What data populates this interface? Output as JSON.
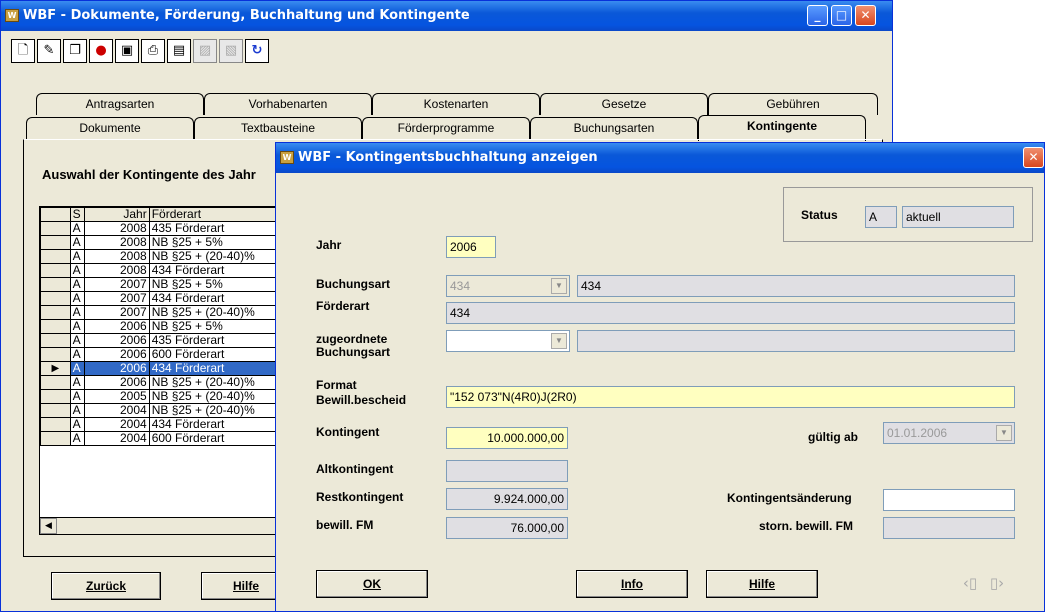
{
  "main_window": {
    "title": "WBF - Dokumente, Förderung, Buchhaltung und Kontingente",
    "controls": {
      "minimize": "_",
      "maximize": "□",
      "close": "✕"
    },
    "tabs_row1": [
      "Antragsarten",
      "Vorhabenarten",
      "Kostenarten",
      "Gesetze",
      "Gebühren"
    ],
    "tabs_row2": [
      "Dokumente",
      "Textbausteine",
      "Förderprogramme",
      "Buchungsarten",
      "Kontingente"
    ],
    "section_title": "Auswahl der Kontingente des Jahr",
    "table": {
      "headers": [
        "S",
        "Jahr",
        "Förderart"
      ],
      "rows": [
        [
          "A",
          "2008",
          "435 Förderart"
        ],
        [
          "A",
          "2008",
          "NB §25 + 5%"
        ],
        [
          "A",
          "2008",
          "NB §25 + (20-40)%"
        ],
        [
          "A",
          "2008",
          "434 Förderart"
        ],
        [
          "A",
          "2007",
          "NB §25 + 5%"
        ],
        [
          "A",
          "2007",
          "434 Förderart"
        ],
        [
          "A",
          "2007",
          "NB §25 + (20-40)%"
        ],
        [
          "A",
          "2006",
          "NB §25 + 5%"
        ],
        [
          "A",
          "2006",
          "435 Förderart"
        ],
        [
          "A",
          "2006",
          "600 Förderart"
        ],
        [
          "A",
          "2006",
          "434 Förderart"
        ],
        [
          "A",
          "2006",
          "NB §25 + (20-40)%"
        ],
        [
          "A",
          "2005",
          "NB §25 + (20-40)%"
        ],
        [
          "A",
          "2004",
          "NB §25 + (20-40)%"
        ],
        [
          "A",
          "2004",
          "434 Förderart"
        ],
        [
          "A",
          "2004",
          "600 Förderart"
        ]
      ],
      "selected_row_index": 10
    },
    "buttons": {
      "back": "Zurück",
      "help": "Hilfe"
    }
  },
  "dialog": {
    "title": "WBF - Kontingentsbuchhaltung anzeigen",
    "close": "✕",
    "status": {
      "label": "Status",
      "code": "A",
      "text": "aktuell"
    },
    "jahr": {
      "label": "Jahr",
      "value": "2006"
    },
    "buchungsart": {
      "label": "Buchungsart",
      "code": "434",
      "text": "434"
    },
    "foerderart": {
      "label": "Förderart",
      "value": "434"
    },
    "zugeordnete": {
      "label_line1": "zugeordnete",
      "label_line2": "Buchungsart",
      "code": "",
      "text": ""
    },
    "format": {
      "label_line1": "Format",
      "label_line2": "Bewill.bescheid",
      "value": "\"152 073\"N(4R0)J(2R0)"
    },
    "kontingent": {
      "label": "Kontingent",
      "value": "10.000.000,00"
    },
    "gueltig_ab": {
      "label": "gültig ab",
      "value": "01.01.2006"
    },
    "altkontingent": {
      "label": "Altkontingent",
      "value": ""
    },
    "restkontingent": {
      "label": "Restkontingent",
      "value": "9.924.000,00"
    },
    "kontingentsaenderung": {
      "label": "Kontingentsänderung",
      "value": ""
    },
    "bewill_fm": {
      "label": "bewill. FM",
      "value": "76.000,00"
    },
    "storn_bewill_fm": {
      "label": "storn. bewill. FM",
      "value": ""
    },
    "buttons": {
      "ok": "OK",
      "info": "Info",
      "help": "Hilfe"
    }
  },
  "icons": [
    "new-document-icon",
    "edit-icon",
    "copy-icon",
    "delete-icon",
    "preview-icon",
    "print-icon",
    "export-icon",
    "disabled-icon",
    "disabled-icon",
    "refresh-icon"
  ],
  "colors": {
    "title_blue": "#0554e0",
    "selection": "#3169c6",
    "field_yellow": "#ffffc0",
    "window_bg": "#ece9d8"
  }
}
